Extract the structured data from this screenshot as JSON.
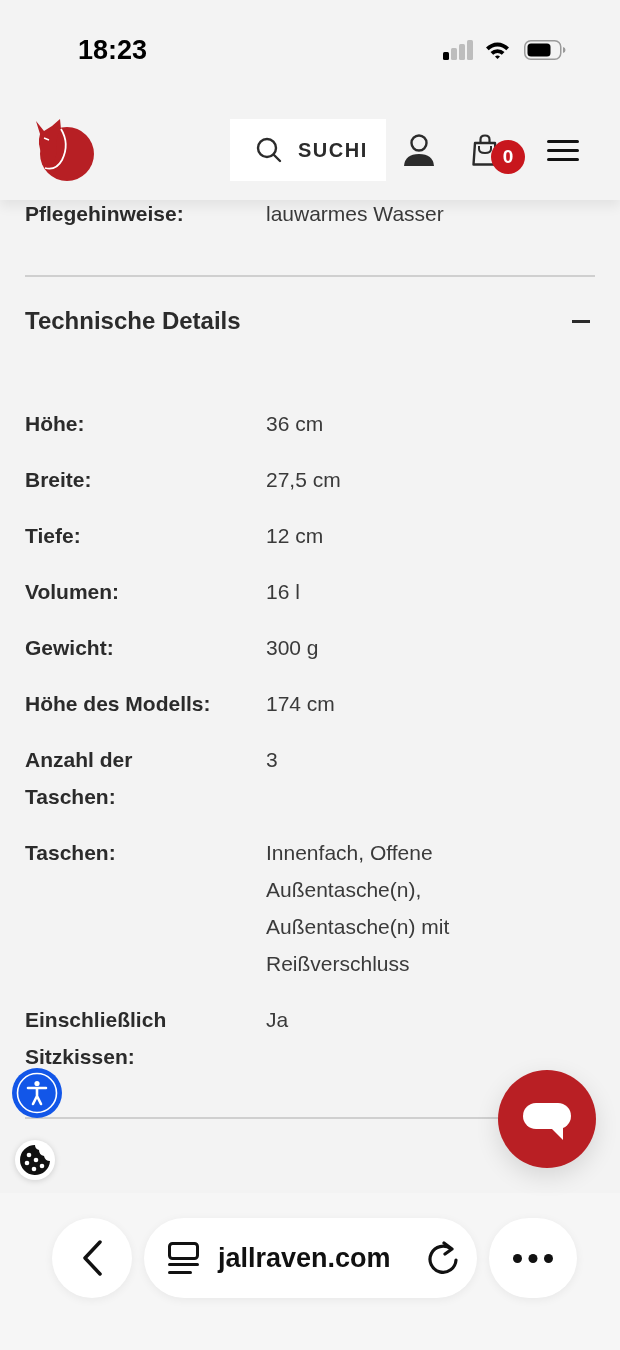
{
  "status_bar": {
    "time": "18:23"
  },
  "header": {
    "search_button": {
      "label": "SUCHI"
    },
    "cart_badge": "0"
  },
  "care_instructions": {
    "label": "Pflegehinweise:",
    "value": "lauwarmes Wasser"
  },
  "technical_details": {
    "title": "Technische Details",
    "expanded": true,
    "rows": [
      {
        "label": "Höhe:",
        "value": "36 cm"
      },
      {
        "label": "Breite:",
        "value": "27,5 cm"
      },
      {
        "label": "Tiefe:",
        "value": "12 cm"
      },
      {
        "label": "Volumen:",
        "value": "16 l"
      },
      {
        "label": "Gewicht:",
        "value": "300 g"
      },
      {
        "label": "Höhe des Modells:",
        "value": "174 cm"
      },
      {
        "label": "Anzahl der Taschen:",
        "value": "3"
      },
      {
        "label": "Taschen:",
        "value": "Innenfach, Offene Außentasche(n), Außentasche(n) mit Reißverschluss"
      },
      {
        "label": "Einschließlich Sitzkissen:",
        "value": "Ja"
      }
    ]
  },
  "browser_bar": {
    "url": "jallraven.com"
  }
}
